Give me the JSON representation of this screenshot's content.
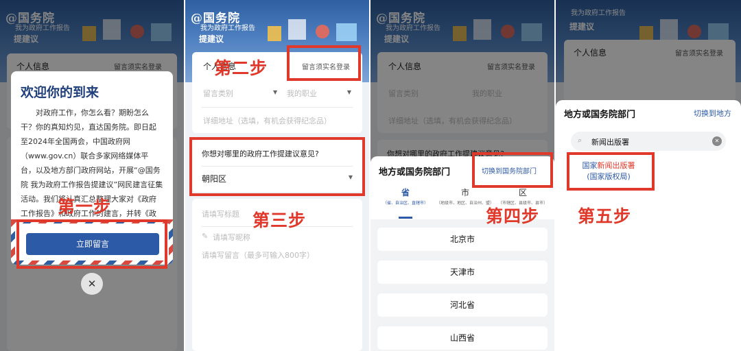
{
  "branding": {
    "name": "@国务院",
    "subtitle": "我为政府工作报告",
    "title": "提建议"
  },
  "common": {
    "personal_info": "个人信息",
    "realname_login": "留言须实名登录",
    "category": "留言类别",
    "occupation": "我的职业",
    "address": "详细地址（选填，有机会获得纪念品）",
    "question": "你想对哪里的政府工作提建议意见?",
    "district": "朝阳区",
    "title_ph": "请填写标题",
    "nickname_ph": "请填写昵称",
    "content_ph": "请填写留言（最多可输入800字）"
  },
  "panel1": {
    "welcome_title": "欢迎你的到来",
    "welcome_text": "对政府工作，你怎么看？期盼怎么干？你的真知灼见，直达国务院。即日起至2024年全国两会，中国政府网（www.gov.cn）联合多家网络媒体平台，以及地方部门政府网站，开展“@国务院 我为政府工作报告提建议”网民建言征集活动。我们将认真汇总整理大家对《政府工作报告》和政府工作的建言，并转《政府工作报告》起草组和有",
    "cta": "立即留言",
    "close": "✕",
    "step": "第一步"
  },
  "panel2": {
    "step2": "第二步",
    "step3": "第三步"
  },
  "panel3": {
    "sheet_title": "地方或国务院部门",
    "switch": "切换到国务院部门",
    "tabs": [
      {
        "label": "省",
        "sub": "（省、自治区、直辖市）"
      },
      {
        "label": "市",
        "sub": "（地级市、地区、自治州、盟）"
      },
      {
        "label": "区",
        "sub": "（市辖区、县级市、县市）"
      }
    ],
    "regions": [
      "北京市",
      "天津市",
      "河北省",
      "山西省"
    ],
    "step": "第四步"
  },
  "panel4": {
    "sheet_title": "地方或国务院部门",
    "switch": "切换到地方",
    "search_value": "新闻出版署",
    "result_prefix": "国家",
    "result_hl": "新闻出版署",
    "result_suffix": "(国家版权局)",
    "step": "第五步"
  },
  "colors": {
    "brand_blue": "#2f5fa0",
    "highlight_red": "#e0392b",
    "cta_blue": "#2d5aa6"
  }
}
